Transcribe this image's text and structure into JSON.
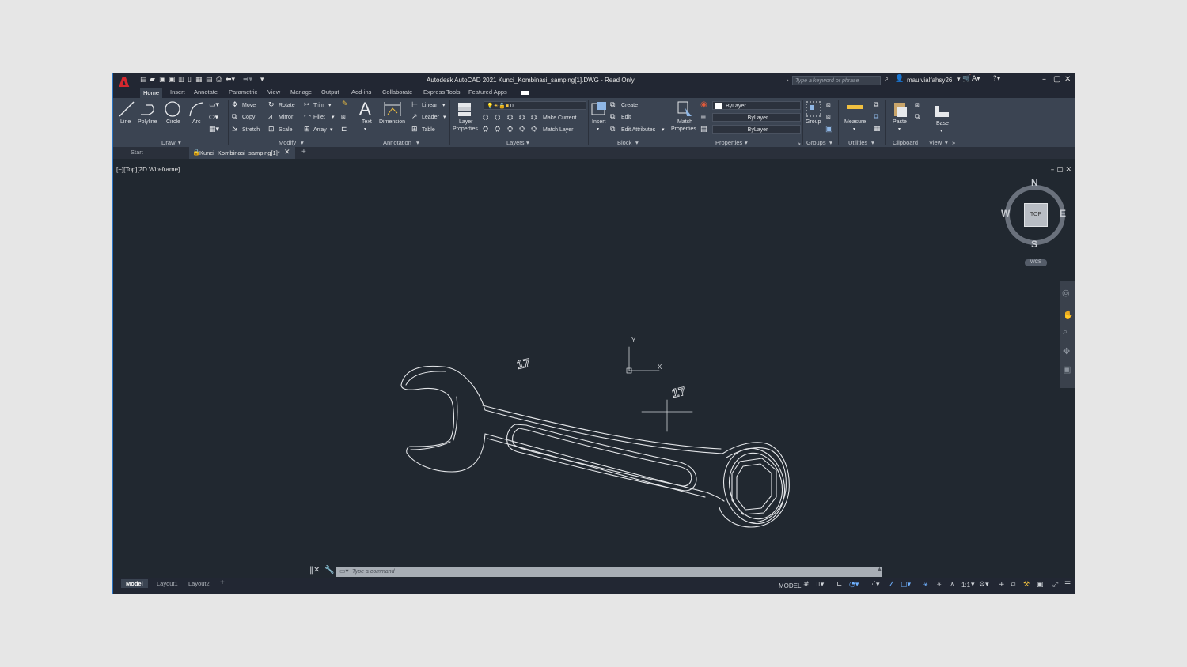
{
  "titlebar": {
    "logo": "A",
    "title": "Autodesk AutoCAD 2021   Kunci_Kombinasi_samping[1].DWG - Read Only",
    "search_placeholder": "Type a keyword or phrase",
    "username": "maulvialfahsy26"
  },
  "ribbon_tabs": [
    "Home",
    "Insert",
    "Annotate",
    "Parametric",
    "View",
    "Manage",
    "Output",
    "Add-ins",
    "Collaborate",
    "Express Tools",
    "Featured Apps"
  ],
  "draw_panel": {
    "title": "Draw",
    "tools": [
      "Line",
      "Polyline",
      "Circle",
      "Arc"
    ]
  },
  "modify_panel": {
    "title": "Modify",
    "tools": [
      "Move",
      "Rotate",
      "Trim",
      "Copy",
      "Mirror",
      "Fillet",
      "Stretch",
      "Scale",
      "Array"
    ]
  },
  "annotation_panel": {
    "title": "Annotation",
    "text": "Text",
    "dimension": "Dimension",
    "linear": "Linear",
    "leader": "Leader",
    "table": "Table"
  },
  "layers_panel": {
    "title": "Layers",
    "layer_properties": "Layer Properties",
    "current_layer": "0",
    "make_current": "Make Current",
    "match_layer": "Match Layer"
  },
  "block_panel": {
    "title": "Block",
    "insert": "Insert",
    "create": "Create",
    "edit": "Edit",
    "edit_attributes": "Edit Attributes"
  },
  "properties_panel": {
    "title": "Properties",
    "match_properties": "Match Properties",
    "color": "ByLayer",
    "lineweight": "ByLayer",
    "linetype": "ByLayer"
  },
  "groups_panel": {
    "title": "Groups",
    "group": "Group"
  },
  "utilities_panel": {
    "title": "Utilities",
    "measure": "Measure"
  },
  "clipboard_panel": {
    "title": "Clipboard",
    "paste": "Paste"
  },
  "view_panel": {
    "title": "View",
    "base": "Base"
  },
  "doc_tabs": {
    "start": "Start",
    "active": "Kunci_Kombinasi_samping[1]*"
  },
  "viewport": {
    "label": "[−][Top][2D Wireframe]",
    "wrench_label": "17"
  },
  "viewcube": {
    "north": "N",
    "south": "S",
    "east": "E",
    "west": "W",
    "face": "TOP",
    "wcs": "WCS"
  },
  "command_line": {
    "placeholder": "Type a command"
  },
  "layout_tabs": [
    "Model",
    "Layout1",
    "Layout2"
  ],
  "status": {
    "model": "MODEL",
    "scale": "1:1"
  },
  "colors": {
    "accent": "#2b74c2",
    "viewport": "#212830",
    "ribbon": "#3b4452",
    "logo": "#d6282e"
  }
}
